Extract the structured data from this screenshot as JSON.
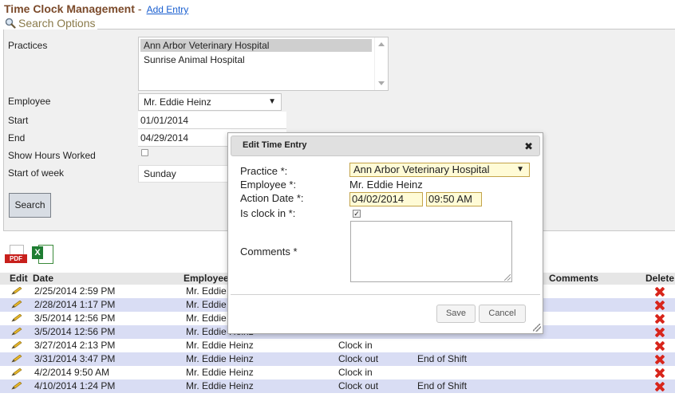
{
  "header": {
    "title": "Time Clock Management",
    "separator": "-",
    "add_entry_label": "Add Entry"
  },
  "search": {
    "legend": "Search Options",
    "practices_label": "Practices",
    "practices": [
      "Ann Arbor Veterinary Hospital",
      "Sunrise Animal Hospital"
    ],
    "employee_label": "Employee",
    "employee_value": "Mr. Eddie Heinz",
    "start_label": "Start",
    "start_value": "01/01/2014",
    "end_label": "End",
    "end_value": "04/29/2014",
    "show_hours_label": "Show Hours Worked",
    "start_of_week_label": "Start of week",
    "start_of_week_value": "Sunday",
    "search_button": "Search"
  },
  "export": {
    "pdf_label": "PDF",
    "excel_label": "X"
  },
  "grid": {
    "headers": {
      "edit": "Edit",
      "date": "Date",
      "employee": "Employee",
      "comments": "Comments",
      "delete": "Delete"
    },
    "rows": [
      {
        "date": "2/25/2014 2:59 PM",
        "employee": "Mr. Eddie",
        "action": "",
        "comment": ""
      },
      {
        "date": "2/28/2014 1:17 PM",
        "employee": "Mr. Eddie",
        "action": "",
        "comment": ""
      },
      {
        "date": "3/5/2014 12:56 PM",
        "employee": "Mr. Eddie",
        "action": "",
        "comment": ""
      },
      {
        "date": "3/5/2014 12:56 PM",
        "employee": "Mr. Eddie Heinz",
        "action": "",
        "comment": ""
      },
      {
        "date": "3/27/2014 2:13 PM",
        "employee": "Mr. Eddie Heinz",
        "action": "Clock in",
        "comment": ""
      },
      {
        "date": "3/31/2014 3:47 PM",
        "employee": "Mr. Eddie Heinz",
        "action": "Clock out",
        "comment": "End of Shift"
      },
      {
        "date": "4/2/2014 9:50 AM",
        "employee": "Mr. Eddie Heinz",
        "action": "Clock in",
        "comment": ""
      },
      {
        "date": "4/10/2014 1:24 PM",
        "employee": "Mr. Eddie Heinz",
        "action": "Clock out",
        "comment": "End of Shift"
      }
    ]
  },
  "dialog": {
    "title": "Edit Time Entry",
    "practice_label": "Practice *:",
    "practice_value": "Ann Arbor Veterinary Hospital",
    "employee_label": "Employee *:",
    "employee_value": "Mr. Eddie Heinz",
    "action_date_label": "Action Date *:",
    "action_date_value": "04/02/2014",
    "action_time_value": "09:50 AM",
    "clock_in_label": "Is clock in *:",
    "comments_label": "Comments *",
    "save_button": "Save",
    "cancel_button": "Cancel"
  }
}
